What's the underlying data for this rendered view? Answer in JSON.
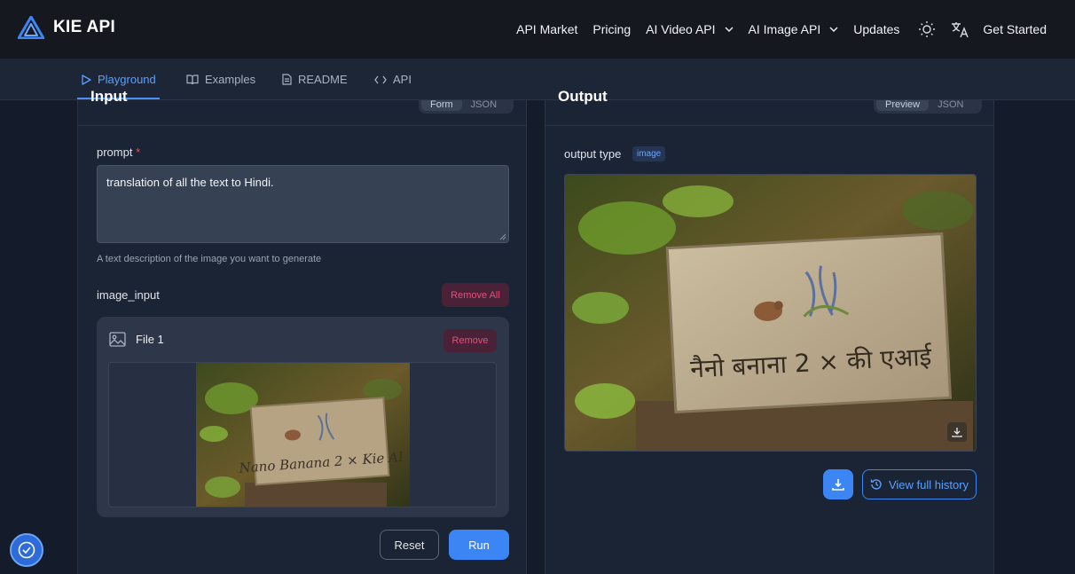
{
  "brand": {
    "name": "KIE API"
  },
  "nav": {
    "items": [
      {
        "label": "API Market"
      },
      {
        "label": "Pricing"
      },
      {
        "label": "AI Video API"
      },
      {
        "label": "AI Image API"
      },
      {
        "label": "Updates"
      }
    ],
    "get_started": "Get Started",
    "icons": [
      "sun-icon",
      "translate-icon"
    ]
  },
  "tabs": [
    {
      "label": "Playground",
      "icon": "play-icon",
      "active": true
    },
    {
      "label": "Examples",
      "icon": "book-icon"
    },
    {
      "label": "README",
      "icon": "document-icon"
    },
    {
      "label": "API",
      "icon": "code-icon"
    }
  ],
  "input_panel": {
    "title": "Input",
    "toggle": [
      "Form",
      "JSON"
    ],
    "prompt_label": "prompt",
    "required_mark": "*",
    "prompt_value": "translation of all the text to Hindi.",
    "prompt_help": "A text description of the image you want to generate",
    "image_input_label": "image_input",
    "remove_all": "Remove All",
    "file": {
      "name": "File 1",
      "remove": "Remove",
      "sign_text": "Nano Banana 2 × Kie AI"
    },
    "reset": "Reset",
    "run": "Run"
  },
  "output_panel": {
    "title": "Output",
    "toggle": [
      "Preview",
      "JSON"
    ],
    "output_type_label": "output type",
    "output_type_value": "image",
    "sign_text": "नैनो बनाना 2 × की एआई",
    "view_history": "View full history"
  },
  "colors": {
    "accent": "#3b86f4",
    "danger": "#e0507a",
    "background": "#141c2b"
  }
}
